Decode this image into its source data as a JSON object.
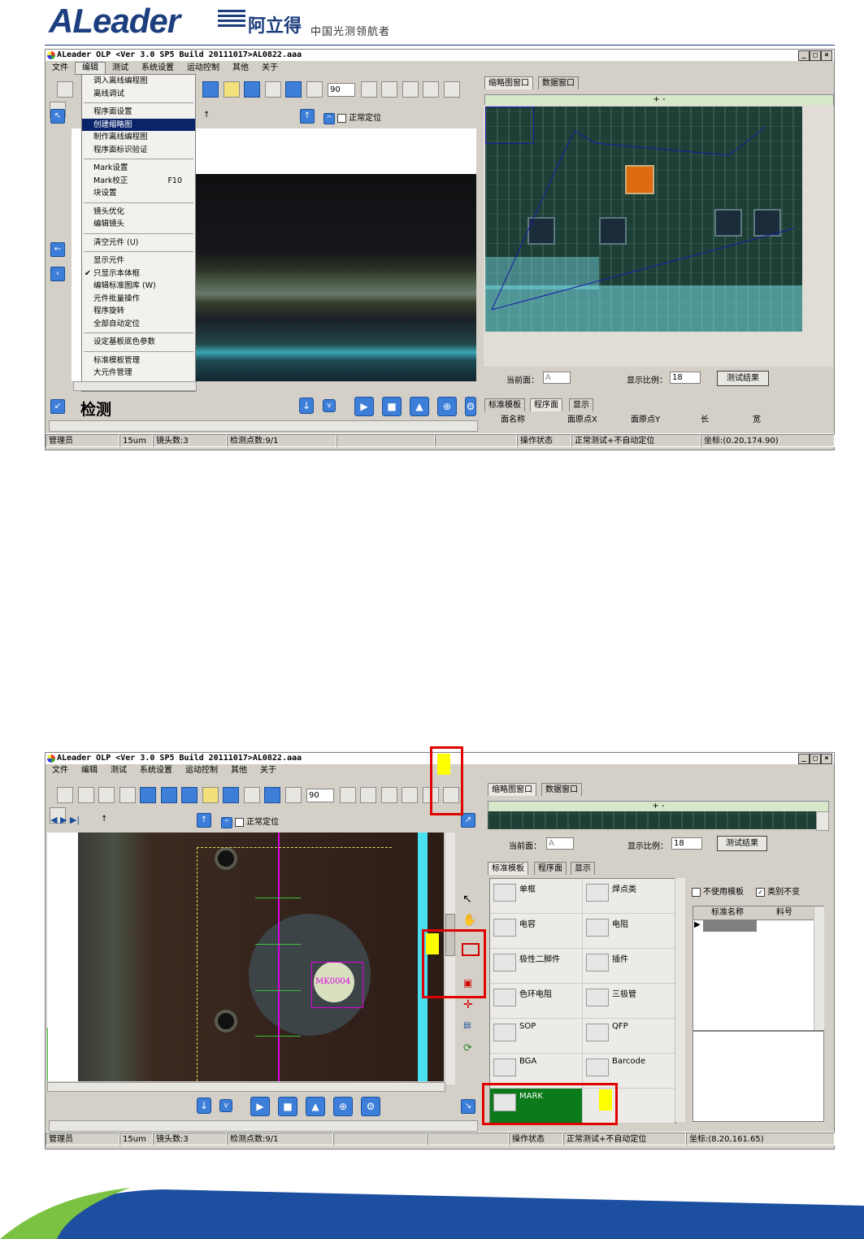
{
  "header": {
    "logo_text": "ALeader",
    "logo_cn": "阿立得",
    "slogan": "中国光测领航者"
  },
  "shot1": {
    "title": "ALeader OLP  <Ver 3.0 SP5  Build 20111017>AL0822.aaa",
    "menus": [
      "文件",
      "编辑",
      "测试",
      "系统设置",
      "运动控制",
      "其他",
      "关于"
    ],
    "active_menu": "编辑",
    "spin_value": "90",
    "normal_locate": "正常定位",
    "arrow_label": "↑",
    "dropdown": [
      {
        "label": "调入离线编程图"
      },
      {
        "label": "离线调试"
      },
      {
        "sep": true
      },
      {
        "label": "程序面设置"
      },
      {
        "label": "创建缩略图",
        "selected": true
      },
      {
        "label": "制作离线编程图"
      },
      {
        "label": "程序面标识验证"
      },
      {
        "sep": true
      },
      {
        "label": "Mark设置"
      },
      {
        "label": "Mark校正",
        "shortcut": "F10"
      },
      {
        "label": "块设置"
      },
      {
        "sep": true
      },
      {
        "label": "镜头优化"
      },
      {
        "label": "编辑镜头"
      },
      {
        "sep": true
      },
      {
        "label": "清空元件 (U)"
      },
      {
        "sep": true
      },
      {
        "label": "显示元件"
      },
      {
        "label": "只显示本体框",
        "checked": true
      },
      {
        "label": "编辑标准图库 (W)"
      },
      {
        "label": "元件批量操作"
      },
      {
        "label": "程序旋转"
      },
      {
        "label": "全部自动定位"
      },
      {
        "sep": true
      },
      {
        "label": "设定基板底色参数"
      },
      {
        "sep": true
      },
      {
        "label": "标准模板管理"
      },
      {
        "label": "大元件管理"
      }
    ],
    "mode_label": "检测",
    "right_tabs": [
      "缩略图窗口",
      "数据窗口"
    ],
    "zoom_controls": "+ -",
    "current_side_label": "当前面：",
    "current_side_value": "A",
    "display_ratio_label": "显示比例：",
    "display_ratio_value": "18",
    "test_result_button": "测试结果",
    "bottom_tabs": [
      "标准模板",
      "程序面",
      "显示"
    ],
    "columns": [
      "面名称",
      "面原点X",
      "面原点Y",
      "长",
      "宽"
    ],
    "status": [
      "管理员",
      "15um",
      "镜头数:3",
      "检测点数:9/1",
      "",
      "",
      "操作状态",
      "正常测试+不自动定位",
      "坐标:(0.20,174.90)"
    ]
  },
  "shot2": {
    "title": "ALeader OLP  <Ver 3.0 SP5  Build 20111017>AL0822.aaa",
    "menus": [
      "文件",
      "编辑",
      "测试",
      "系统设置",
      "运动控制",
      "其他",
      "关于"
    ],
    "spin_value": "90",
    "normal_locate": "正常定位",
    "arrow_label": "↑",
    "mark_label": "MK0004",
    "right_tabs": [
      "缩略图窗口",
      "数据窗口"
    ],
    "zoom_controls": "+ -",
    "current_side_label": "当前面：",
    "current_side_value": "A",
    "display_ratio_label": "显示比例：",
    "display_ratio_value": "18",
    "test_result_button": "测试结果",
    "bottom_tabs": [
      "标准模板",
      "程序面",
      "显示"
    ],
    "templates": [
      [
        "单框",
        "焊点类"
      ],
      [
        "电容",
        "电阻"
      ],
      [
        "极性二脚件",
        "插件"
      ],
      [
        "色环电阻",
        "三极管"
      ],
      [
        "SOP",
        "QFP"
      ],
      [
        "BGA",
        "Barcode"
      ],
      [
        "MARK",
        ""
      ]
    ],
    "no_template_label": "不使用模板",
    "keep_category_label": "类别不变",
    "table_headers": [
      "标准名称",
      "料号"
    ],
    "status": [
      "管理员",
      "15um",
      "镜头数:3",
      "检测点数:9/1",
      "",
      "",
      "操作状态",
      "正常测试+不自动定位",
      "坐标:(8.20,161.65)"
    ]
  },
  "colors": {
    "brand": "#1d3e7e",
    "window_bg": "#d4d0c8",
    "menu_selected": "#0a246a",
    "highlight": "#e00000",
    "marker": "#ffff00",
    "mark_cell": "#0a7a1a",
    "magenta_line": "#e000e0",
    "swoosh_green": "#7cc242"
  }
}
